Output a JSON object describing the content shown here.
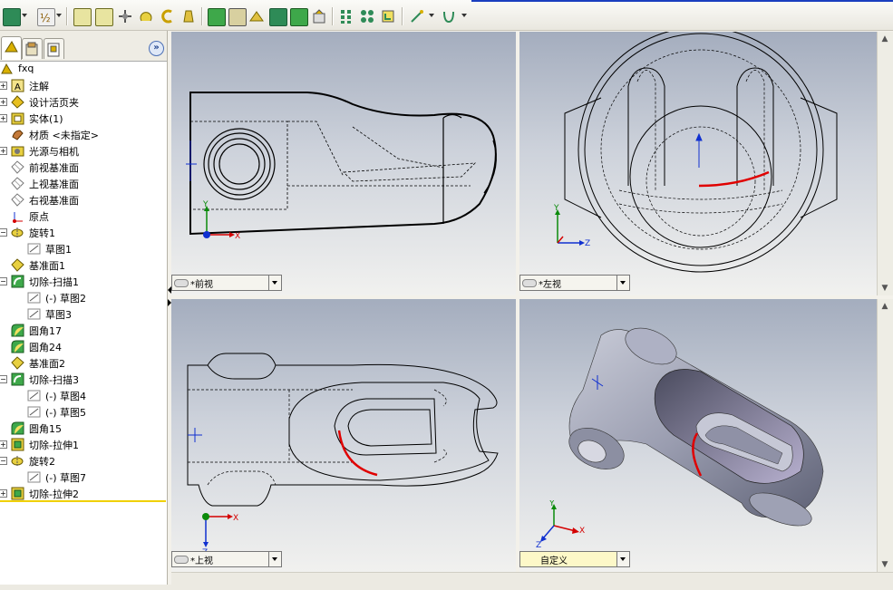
{
  "toolbar": {
    "icons": [
      "view-orientation-icon",
      "display-style-icon",
      "zoom-to-fit-icon",
      "zoom-area-icon",
      "pan-icon",
      "rotate-icon",
      "roll-icon",
      "lighting-icon",
      "shaded-icon",
      "hidden-lines-icon",
      "section-view-icon",
      "normal-to-icon",
      "view-selector-icon",
      "grid-icon",
      "standard-views-icon",
      "sketch-icon",
      "reference-geometry-icon",
      "curves-icon"
    ]
  },
  "left_panel": {
    "tabs": [
      "featuremanager-tab",
      "propertymanager-tab",
      "configurationmanager-tab"
    ],
    "expand_button": "»",
    "tree": [
      {
        "label": "fxq",
        "icon": "part-icon",
        "level": 0,
        "expander": ""
      },
      {
        "label": "注解",
        "icon": "annotations-icon",
        "level": 1,
        "expander": "+"
      },
      {
        "label": "设计活页夹",
        "icon": "design-binder-icon",
        "level": 1,
        "expander": "+"
      },
      {
        "label": "实体(1)",
        "icon": "solid-bodies-icon",
        "level": 1,
        "expander": "+"
      },
      {
        "label": "材质 <未指定>",
        "icon": "material-icon",
        "level": 1,
        "expander": ""
      },
      {
        "label": "光源与相机",
        "icon": "lights-cameras-icon",
        "level": 1,
        "expander": "+"
      },
      {
        "label": "前视基准面",
        "icon": "plane-icon",
        "level": 1,
        "expander": ""
      },
      {
        "label": "上视基准面",
        "icon": "plane-icon",
        "level": 1,
        "expander": ""
      },
      {
        "label": "右视基准面",
        "icon": "plane-icon",
        "level": 1,
        "expander": ""
      },
      {
        "label": "原点",
        "icon": "origin-icon",
        "level": 1,
        "expander": ""
      },
      {
        "label": "旋转1",
        "icon": "revolve-icon",
        "level": 1,
        "expander": "−"
      },
      {
        "label": "草图1",
        "icon": "sketch-icon",
        "level": 2,
        "expander": ""
      },
      {
        "label": "基准面1",
        "icon": "plane-feature-icon",
        "level": 1,
        "expander": ""
      },
      {
        "label": "切除-扫描1",
        "icon": "swept-cut-icon",
        "level": 1,
        "expander": "−"
      },
      {
        "label": "(-) 草图2",
        "icon": "sketch-icon",
        "level": 2,
        "expander": ""
      },
      {
        "label": "草图3",
        "icon": "sketch-icon",
        "level": 2,
        "expander": ""
      },
      {
        "label": "圆角17",
        "icon": "fillet-icon",
        "level": 1,
        "expander": ""
      },
      {
        "label": "圆角24",
        "icon": "fillet-icon",
        "level": 1,
        "expander": ""
      },
      {
        "label": "基准面2",
        "icon": "plane-feature-icon",
        "level": 1,
        "expander": ""
      },
      {
        "label": "切除-扫描3",
        "icon": "swept-cut-icon",
        "level": 1,
        "expander": "−"
      },
      {
        "label": "(-) 草图4",
        "icon": "sketch-icon",
        "level": 2,
        "expander": ""
      },
      {
        "label": "(-) 草图5",
        "icon": "sketch-icon",
        "level": 2,
        "expander": ""
      },
      {
        "label": "圆角15",
        "icon": "fillet-icon",
        "level": 1,
        "expander": ""
      },
      {
        "label": "切除-拉伸1",
        "icon": "extruded-cut-icon",
        "level": 1,
        "expander": "+"
      },
      {
        "label": "旋转2",
        "icon": "revolve-icon",
        "level": 1,
        "expander": "−"
      },
      {
        "label": "(-) 草图7",
        "icon": "sketch-icon",
        "level": 2,
        "expander": ""
      },
      {
        "label": "切除-拉伸2",
        "icon": "extruded-cut-icon",
        "level": 1,
        "expander": "+"
      }
    ]
  },
  "viewports": {
    "front": {
      "label": "*前视"
    },
    "left": {
      "label": "*左视"
    },
    "top": {
      "label": "*上视"
    },
    "custom": {
      "label": "自定义"
    }
  },
  "axes": {
    "x": "X",
    "y": "Y",
    "z": "Z"
  },
  "colors": {
    "x_axis": "#d40000",
    "y_axis": "#0a8a0a",
    "z_axis": "#1030d0",
    "curve": "#e00000"
  }
}
